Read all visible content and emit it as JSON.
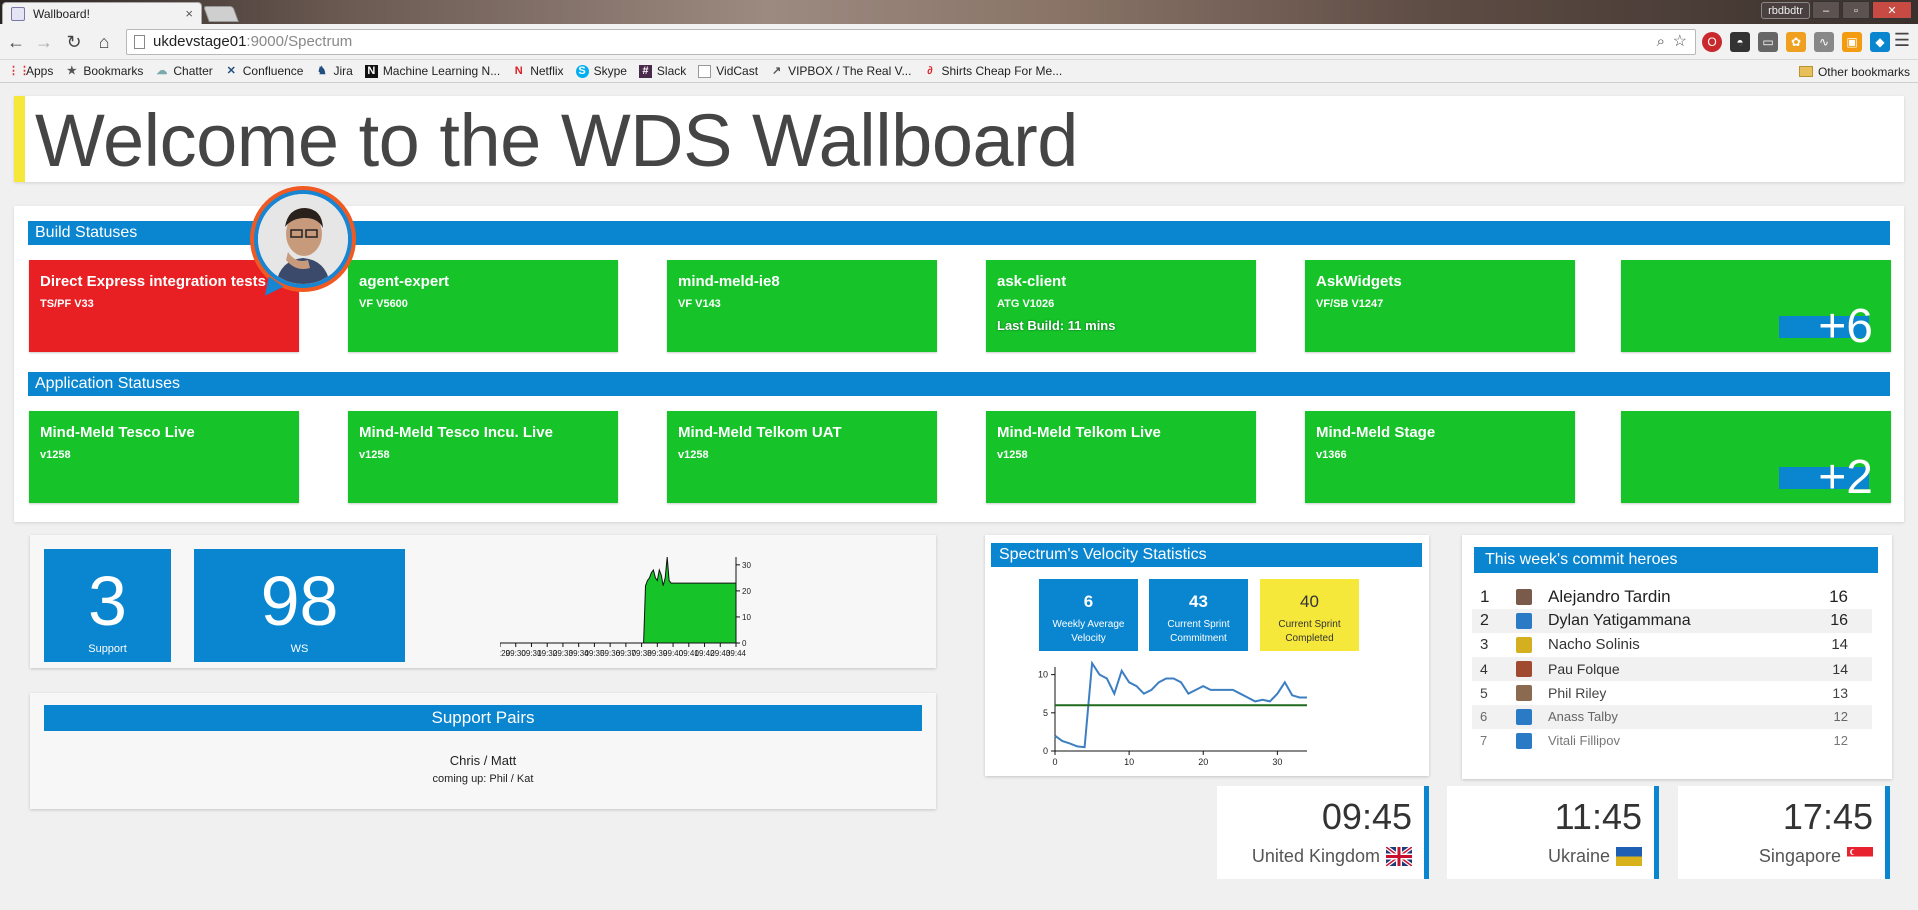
{
  "browser": {
    "tab_title": "Wallboard!",
    "tab_close": "×",
    "profile_name": "rbdbdtr",
    "url_host": "ukdevstage01",
    "url_path": ":9000/Spectrum",
    "bookmarks": [
      {
        "label": "Apps",
        "icon": "apps-grid-icon"
      },
      {
        "label": "Bookmarks",
        "icon": "star-icon"
      },
      {
        "label": "Chatter",
        "icon": "cloud-icon"
      },
      {
        "label": "Confluence",
        "icon": "confluence-icon"
      },
      {
        "label": "Jira",
        "icon": "jira-icon"
      },
      {
        "label": "Machine Learning N...",
        "icon": "n-logo-icon"
      },
      {
        "label": "Netflix",
        "icon": "netflix-icon"
      },
      {
        "label": "Skype",
        "icon": "skype-icon"
      },
      {
        "label": "Slack",
        "icon": "slack-icon"
      },
      {
        "label": "VidCast",
        "icon": "page-icon"
      },
      {
        "label": "VIPBOX / The Real V...",
        "icon": "vipbox-icon"
      },
      {
        "label": "Shirts Cheap For Me...",
        "icon": "shirt-site-icon"
      }
    ],
    "other_bookmarks": "Other bookmarks"
  },
  "header": {
    "title": "Welcome to the WDS Wallboard"
  },
  "build_statuses": {
    "title": "Build Statuses",
    "tiles": [
      {
        "name": "Direct Express integration tests",
        "version": "TS/PF V33",
        "status": "failed"
      },
      {
        "name": "agent-expert",
        "version": "VF V5600",
        "status": "passed"
      },
      {
        "name": "mind-meld-ie8",
        "version": "VF V143",
        "status": "passed"
      },
      {
        "name": "ask-client",
        "version": "ATG V1026",
        "last_build": "Last Build: 11 mins",
        "status": "passed"
      },
      {
        "name": "AskWidgets",
        "version": "VF/SB V1247",
        "status": "passed"
      }
    ],
    "more": "+6"
  },
  "application_statuses": {
    "title": "Application Statuses",
    "tiles": [
      {
        "name": "Mind-Meld Tesco Live",
        "version": "v1258"
      },
      {
        "name": "Mind-Meld Tesco Incu. Live",
        "version": "v1258"
      },
      {
        "name": "Mind-Meld Telkom UAT",
        "version": "v1258"
      },
      {
        "name": "Mind-Meld Telkom Live",
        "version": "v1258"
      },
      {
        "name": "Mind-Meld Stage",
        "version": "v1366"
      }
    ],
    "more": "+2"
  },
  "counters": [
    {
      "value": "3",
      "label": "Support"
    },
    {
      "value": "98",
      "label": "WS"
    }
  ],
  "support_pairs": {
    "title": "Support Pairs",
    "current": "Chris / Matt",
    "next": "coming up: Phil / Kat"
  },
  "velocity": {
    "title": "Spectrum's Velocity Statistics",
    "stats": [
      {
        "value": "6",
        "label": "Weekly Average Velocity"
      },
      {
        "value": "43",
        "label": "Current Sprint Commitment"
      },
      {
        "value": "40",
        "label": "Current Sprint Completed"
      }
    ]
  },
  "commit_heroes": {
    "title": "This week's commit heroes",
    "rows": [
      {
        "rank": "1",
        "name": "Alejandro Tardin",
        "count": "16"
      },
      {
        "rank": "2",
        "name": "Dylan Yatigammana",
        "count": "16"
      },
      {
        "rank": "3",
        "name": "Nacho Solinis",
        "count": "14"
      },
      {
        "rank": "4",
        "name": "Pau Folque",
        "count": "14"
      },
      {
        "rank": "5",
        "name": "Phil Riley",
        "count": "13"
      },
      {
        "rank": "6",
        "name": "Anass Talby",
        "count": "12"
      },
      {
        "rank": "7",
        "name": "Vitali Fillipov",
        "count": "12"
      }
    ]
  },
  "clocks": [
    {
      "time": "09:45",
      "place": "United Kingdom"
    },
    {
      "time": "11:45",
      "place": "Ukraine"
    },
    {
      "time": "17:45",
      "place": "Singapore"
    }
  ],
  "chart_data": [
    {
      "type": "area",
      "title": "",
      "y_ticks": [
        "0",
        "10",
        "20",
        "30"
      ],
      "ylim": [
        0,
        33
      ],
      "x_ticks": [
        "09:29",
        "09:30",
        "09:31",
        "09:32",
        "09:33",
        "09:34",
        "09:35",
        "09:36",
        "09:37",
        "09:38",
        "09:39",
        "09:40",
        "09:41",
        "09:42",
        "09:43",
        "09:44"
      ],
      "values": [
        0,
        0,
        0,
        0,
        0,
        0,
        0,
        0,
        0,
        0,
        0,
        0,
        0,
        0,
        0,
        0,
        0,
        0,
        0,
        0,
        0,
        0,
        0,
        0,
        0,
        0,
        0,
        0,
        0,
        0,
        0,
        0,
        0,
        0,
        0,
        0,
        0,
        0,
        0,
        0,
        0,
        0,
        0,
        0,
        0,
        0,
        0,
        0,
        0,
        0,
        0,
        0,
        0,
        0,
        0,
        0,
        0,
        0,
        0,
        0,
        0,
        0,
        0,
        0,
        0,
        0,
        0,
        0,
        0,
        0,
        0,
        0,
        0,
        0,
        22,
        24,
        25,
        27,
        28,
        25,
        24,
        28,
        26,
        22,
        25,
        33,
        24,
        23,
        23,
        23,
        23,
        23,
        23,
        23,
        23,
        23,
        23,
        23,
        23,
        23,
        23,
        23,
        23,
        23,
        23,
        23,
        23,
        23,
        23,
        23,
        23,
        23,
        23,
        23,
        23,
        23,
        23,
        23,
        23,
        23,
        23
      ],
      "color": "#16c42a"
    },
    {
      "type": "line",
      "title": "",
      "x_ticks": [
        "0",
        "10",
        "20",
        "30"
      ],
      "y_ticks": [
        "0",
        "5",
        "10"
      ],
      "xlim": [
        0,
        34
      ],
      "ylim": [
        0,
        11
      ],
      "series": [
        {
          "values": [
            2,
            1.3,
            1,
            0.6,
            0.5,
            11.5,
            10,
            9.5,
            7.5,
            10.5,
            9,
            8.5,
            7.5,
            8,
            9,
            9.5,
            9.5,
            9,
            7.5,
            8,
            8.5,
            8,
            8,
            8,
            8,
            7.5,
            7,
            6.5,
            6.7,
            6.5,
            7.5,
            9,
            7.3,
            7,
            7
          ],
          "color": "#3d7fc2"
        },
        {
          "values": [
            6,
            6,
            6,
            6,
            6,
            6,
            6,
            6,
            6,
            6,
            6,
            6,
            6,
            6,
            6,
            6,
            6,
            6,
            6,
            6,
            6,
            6,
            6,
            6,
            6,
            6,
            6,
            6,
            6,
            6,
            6,
            6,
            6,
            6,
            6
          ],
          "color": "#1f6a1f"
        }
      ]
    }
  ]
}
